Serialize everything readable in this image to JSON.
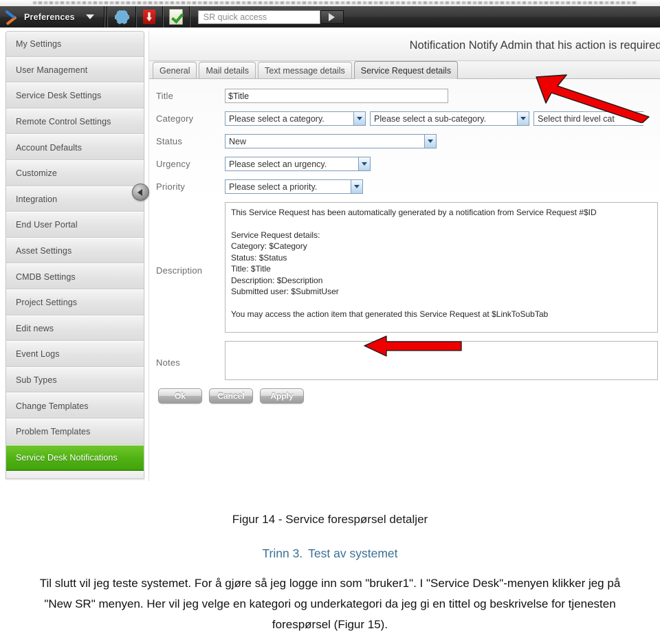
{
  "toolbar": {
    "prefs_label": "Preferences",
    "prefs_icon": "screwdriver-wrench-icon",
    "caret_icon": "chevron-down-icon",
    "gear_icon": "gear-icon",
    "pdf_icon": "pdf-icon",
    "checkdoc_icon": "checked-document-icon",
    "quick_access_placeholder": "SR quick access",
    "quick_access_value": "",
    "go_icon": "play-arrow-icon"
  },
  "sidebar": {
    "collapse_icon": "chevron-left-icon",
    "items": [
      {
        "label": "My Settings",
        "selected": false
      },
      {
        "label": "User Management",
        "selected": false
      },
      {
        "label": "Service Desk Settings",
        "selected": false
      },
      {
        "label": "Remote Control Settings",
        "selected": false
      },
      {
        "label": "Account Defaults",
        "selected": false
      },
      {
        "label": "Customize",
        "selected": false
      },
      {
        "label": "Integration",
        "selected": false
      },
      {
        "label": "End User Portal",
        "selected": false
      },
      {
        "label": "Asset Settings",
        "selected": false
      },
      {
        "label": "CMDB Settings",
        "selected": false
      },
      {
        "label": "Project Settings",
        "selected": false
      },
      {
        "label": "Edit news",
        "selected": false
      },
      {
        "label": "Event Logs",
        "selected": false
      },
      {
        "label": "Sub Types",
        "selected": false
      },
      {
        "label": "Change Templates",
        "selected": false
      },
      {
        "label": "Problem Templates",
        "selected": false
      },
      {
        "label": "Service Desk Notifications",
        "selected": true
      },
      {
        "label": "",
        "selected": false
      }
    ]
  },
  "panel": {
    "title": "Notification Notify Admin that his action is required.",
    "tabs": [
      {
        "label": "General",
        "active": false
      },
      {
        "label": "Mail details",
        "active": false
      },
      {
        "label": "Text message details",
        "active": false
      },
      {
        "label": "Service Request details",
        "active": true
      }
    ]
  },
  "form": {
    "title": {
      "label": "Title",
      "value": "$Title"
    },
    "category": {
      "label": "Category",
      "level1": "Please select a category.",
      "level2": "Please select a sub-category.",
      "level3": "Select third level cat"
    },
    "status": {
      "label": "Status",
      "value": "New"
    },
    "urgency": {
      "label": "Urgency",
      "value": "Please select an urgency."
    },
    "priority": {
      "label": "Priority",
      "value": "Please select a priority."
    },
    "description": {
      "label": "Description",
      "lines": [
        "This Service Request has been automatically generated by a notification from Service Request #$ID",
        "",
        "Service Request details:",
        "Category: $Category",
        "Status: $Status",
        "Title: $Title",
        "Description: $Description",
        "Submitted user: $SubmitUser",
        "",
        "You may access the action item that generated this Service Request at  $LinkToSubTab"
      ]
    },
    "notes": {
      "label": "Notes",
      "value": ""
    },
    "buttons": [
      {
        "label": "Ok"
      },
      {
        "label": "Cancel"
      },
      {
        "label": "Apply"
      }
    ]
  },
  "annotations": {
    "arrow_tab_name": "red-arrow-pointing-to-service-request-details-tab",
    "arrow_desc_name": "red-arrow-pointing-to-submitted-user-line",
    "arrow_color": "#ee0000"
  },
  "document": {
    "caption": "Figur 14 - Service forespørsel detaljer",
    "step_number": "Trinn 3.",
    "step_title": "Test av systemet",
    "paragraph": "Til slutt vil jeg teste systemet.  For å gjøre så jeg logge inn som \"bruker1\".  I \"Service Desk\"-menyen klikker jeg på \"New SR\" menyen.  Her vil jeg velge en kategori og underkategori da jeg gi en tittel og beskrivelse for tjenesten forespørsel (Figur 15)."
  }
}
